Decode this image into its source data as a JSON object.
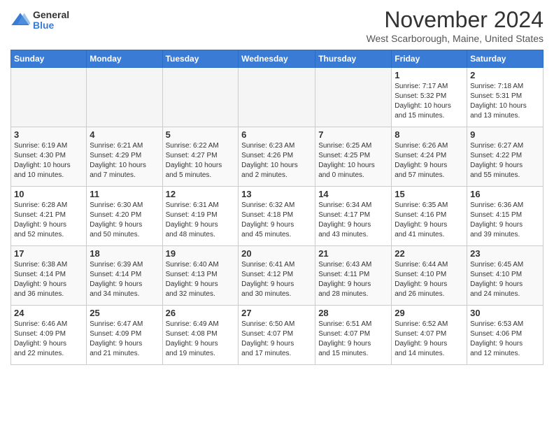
{
  "logo": {
    "general": "General",
    "blue": "Blue"
  },
  "title": "November 2024",
  "location": "West Scarborough, Maine, United States",
  "weekdays": [
    "Sunday",
    "Monday",
    "Tuesday",
    "Wednesday",
    "Thursday",
    "Friday",
    "Saturday"
  ],
  "weeks": [
    [
      {
        "day": "",
        "info": ""
      },
      {
        "day": "",
        "info": ""
      },
      {
        "day": "",
        "info": ""
      },
      {
        "day": "",
        "info": ""
      },
      {
        "day": "",
        "info": ""
      },
      {
        "day": "1",
        "info": "Sunrise: 7:17 AM\nSunset: 5:32 PM\nDaylight: 10 hours\nand 15 minutes."
      },
      {
        "day": "2",
        "info": "Sunrise: 7:18 AM\nSunset: 5:31 PM\nDaylight: 10 hours\nand 13 minutes."
      }
    ],
    [
      {
        "day": "3",
        "info": "Sunrise: 6:19 AM\nSunset: 4:30 PM\nDaylight: 10 hours\nand 10 minutes."
      },
      {
        "day": "4",
        "info": "Sunrise: 6:21 AM\nSunset: 4:29 PM\nDaylight: 10 hours\nand 7 minutes."
      },
      {
        "day": "5",
        "info": "Sunrise: 6:22 AM\nSunset: 4:27 PM\nDaylight: 10 hours\nand 5 minutes."
      },
      {
        "day": "6",
        "info": "Sunrise: 6:23 AM\nSunset: 4:26 PM\nDaylight: 10 hours\nand 2 minutes."
      },
      {
        "day": "7",
        "info": "Sunrise: 6:25 AM\nSunset: 4:25 PM\nDaylight: 10 hours\nand 0 minutes."
      },
      {
        "day": "8",
        "info": "Sunrise: 6:26 AM\nSunset: 4:24 PM\nDaylight: 9 hours\nand 57 minutes."
      },
      {
        "day": "9",
        "info": "Sunrise: 6:27 AM\nSunset: 4:22 PM\nDaylight: 9 hours\nand 55 minutes."
      }
    ],
    [
      {
        "day": "10",
        "info": "Sunrise: 6:28 AM\nSunset: 4:21 PM\nDaylight: 9 hours\nand 52 minutes."
      },
      {
        "day": "11",
        "info": "Sunrise: 6:30 AM\nSunset: 4:20 PM\nDaylight: 9 hours\nand 50 minutes."
      },
      {
        "day": "12",
        "info": "Sunrise: 6:31 AM\nSunset: 4:19 PM\nDaylight: 9 hours\nand 48 minutes."
      },
      {
        "day": "13",
        "info": "Sunrise: 6:32 AM\nSunset: 4:18 PM\nDaylight: 9 hours\nand 45 minutes."
      },
      {
        "day": "14",
        "info": "Sunrise: 6:34 AM\nSunset: 4:17 PM\nDaylight: 9 hours\nand 43 minutes."
      },
      {
        "day": "15",
        "info": "Sunrise: 6:35 AM\nSunset: 4:16 PM\nDaylight: 9 hours\nand 41 minutes."
      },
      {
        "day": "16",
        "info": "Sunrise: 6:36 AM\nSunset: 4:15 PM\nDaylight: 9 hours\nand 39 minutes."
      }
    ],
    [
      {
        "day": "17",
        "info": "Sunrise: 6:38 AM\nSunset: 4:14 PM\nDaylight: 9 hours\nand 36 minutes."
      },
      {
        "day": "18",
        "info": "Sunrise: 6:39 AM\nSunset: 4:14 PM\nDaylight: 9 hours\nand 34 minutes."
      },
      {
        "day": "19",
        "info": "Sunrise: 6:40 AM\nSunset: 4:13 PM\nDaylight: 9 hours\nand 32 minutes."
      },
      {
        "day": "20",
        "info": "Sunrise: 6:41 AM\nSunset: 4:12 PM\nDaylight: 9 hours\nand 30 minutes."
      },
      {
        "day": "21",
        "info": "Sunrise: 6:43 AM\nSunset: 4:11 PM\nDaylight: 9 hours\nand 28 minutes."
      },
      {
        "day": "22",
        "info": "Sunrise: 6:44 AM\nSunset: 4:10 PM\nDaylight: 9 hours\nand 26 minutes."
      },
      {
        "day": "23",
        "info": "Sunrise: 6:45 AM\nSunset: 4:10 PM\nDaylight: 9 hours\nand 24 minutes."
      }
    ],
    [
      {
        "day": "24",
        "info": "Sunrise: 6:46 AM\nSunset: 4:09 PM\nDaylight: 9 hours\nand 22 minutes."
      },
      {
        "day": "25",
        "info": "Sunrise: 6:47 AM\nSunset: 4:09 PM\nDaylight: 9 hours\nand 21 minutes."
      },
      {
        "day": "26",
        "info": "Sunrise: 6:49 AM\nSunset: 4:08 PM\nDaylight: 9 hours\nand 19 minutes."
      },
      {
        "day": "27",
        "info": "Sunrise: 6:50 AM\nSunset: 4:07 PM\nDaylight: 9 hours\nand 17 minutes."
      },
      {
        "day": "28",
        "info": "Sunrise: 6:51 AM\nSunset: 4:07 PM\nDaylight: 9 hours\nand 15 minutes."
      },
      {
        "day": "29",
        "info": "Sunrise: 6:52 AM\nSunset: 4:07 PM\nDaylight: 9 hours\nand 14 minutes."
      },
      {
        "day": "30",
        "info": "Sunrise: 6:53 AM\nSunset: 4:06 PM\nDaylight: 9 hours\nand 12 minutes."
      }
    ]
  ]
}
